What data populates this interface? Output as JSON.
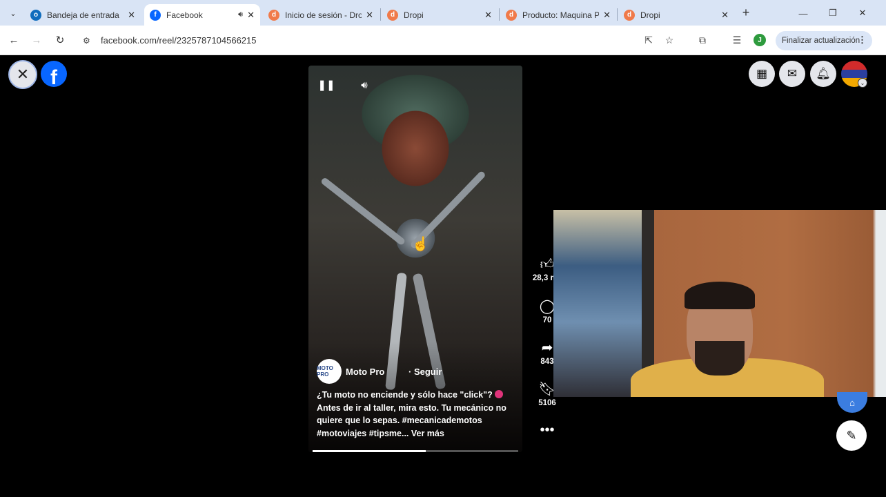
{
  "browser": {
    "tabs": [
      {
        "title": "Bandeja de entrada",
        "favicon": "outlook-icon",
        "active": false
      },
      {
        "title": "Facebook",
        "favicon": "facebook-icon",
        "active": true,
        "audio": true
      },
      {
        "title": "Inicio de sesión - Dro",
        "favicon": "dropi-icon",
        "active": false
      },
      {
        "title": "Dropi",
        "favicon": "dropi-icon",
        "active": false
      },
      {
        "title": "Producto: Maquina P",
        "favicon": "dropi-icon",
        "active": false
      },
      {
        "title": "Dropi",
        "favicon": "dropi-icon",
        "active": false
      }
    ],
    "url": "facebook.com/reel/2325787104566215",
    "profile_initial": "J",
    "update_label": "Finalizar actualización"
  },
  "reel": {
    "page_name": "Moto Pro",
    "follow_label": "· Seguir",
    "avatar_text": "MOTO PRO",
    "caption": "¿Tu moto no enciende y sólo hace \"click\"?",
    "caption_rest": "Antes de ir al taller, mira esto. Tu mecánico no quiere que lo sepas. #mecanicademotos #motoviajes #tipsme...",
    "see_more": "Ver más",
    "progress": 0.55
  },
  "actions": {
    "likes": "28,3 mil",
    "comments": "70",
    "shares": "843",
    "saves": "5106"
  },
  "colors": {
    "facebook_blue": "#0866ff",
    "tabstrip": "#d9e4f5"
  }
}
